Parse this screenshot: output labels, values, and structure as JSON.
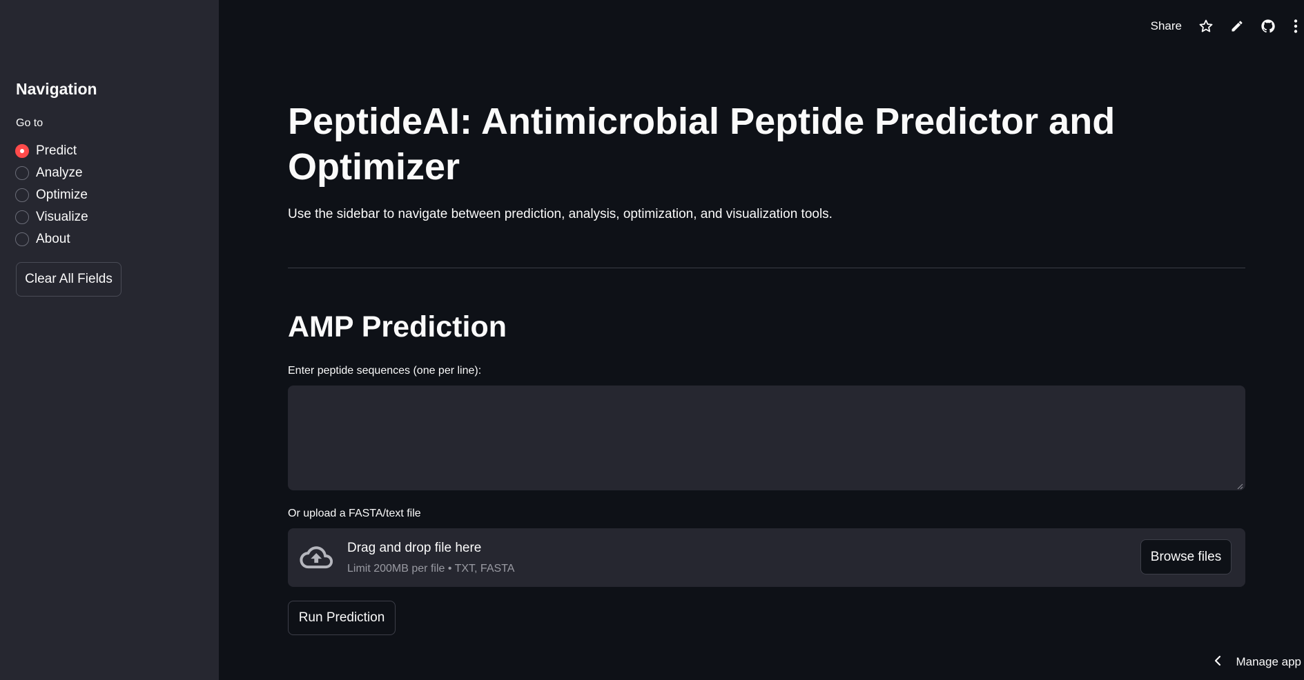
{
  "sidebar": {
    "title": "Navigation",
    "radio_label": "Go to",
    "options": [
      {
        "label": "Predict",
        "selected": true
      },
      {
        "label": "Analyze",
        "selected": false
      },
      {
        "label": "Optimize",
        "selected": false
      },
      {
        "label": "Visualize",
        "selected": false
      },
      {
        "label": "About",
        "selected": false
      }
    ],
    "clear_button": "Clear All Fields"
  },
  "toolbar": {
    "share_label": "Share",
    "icons": [
      "star-icon",
      "pencil-icon",
      "github-icon",
      "kebab-menu-icon"
    ]
  },
  "main": {
    "title": "PeptideAI: Antimicrobial Peptide Predictor and Optimizer",
    "subtitle": "Use the sidebar to navigate between prediction, analysis, optimization, and visualization tools.",
    "section_title": "AMP Prediction",
    "sequence_input": {
      "label": "Enter peptide sequences (one per line):",
      "value": "",
      "placeholder": ""
    },
    "upload": {
      "label": "Or upload a FASTA/text file",
      "drop_text": "Drag and drop file here",
      "limit_text": "Limit 200MB per file • TXT, FASTA",
      "browse_button": "Browse files"
    },
    "run_button": "Run Prediction"
  },
  "footer": {
    "manage_app": "Manage app"
  },
  "colors": {
    "background": "#0e1117",
    "sidebar_bg": "#262730",
    "accent": "#ff4b4b",
    "input_bg": "#262730"
  }
}
